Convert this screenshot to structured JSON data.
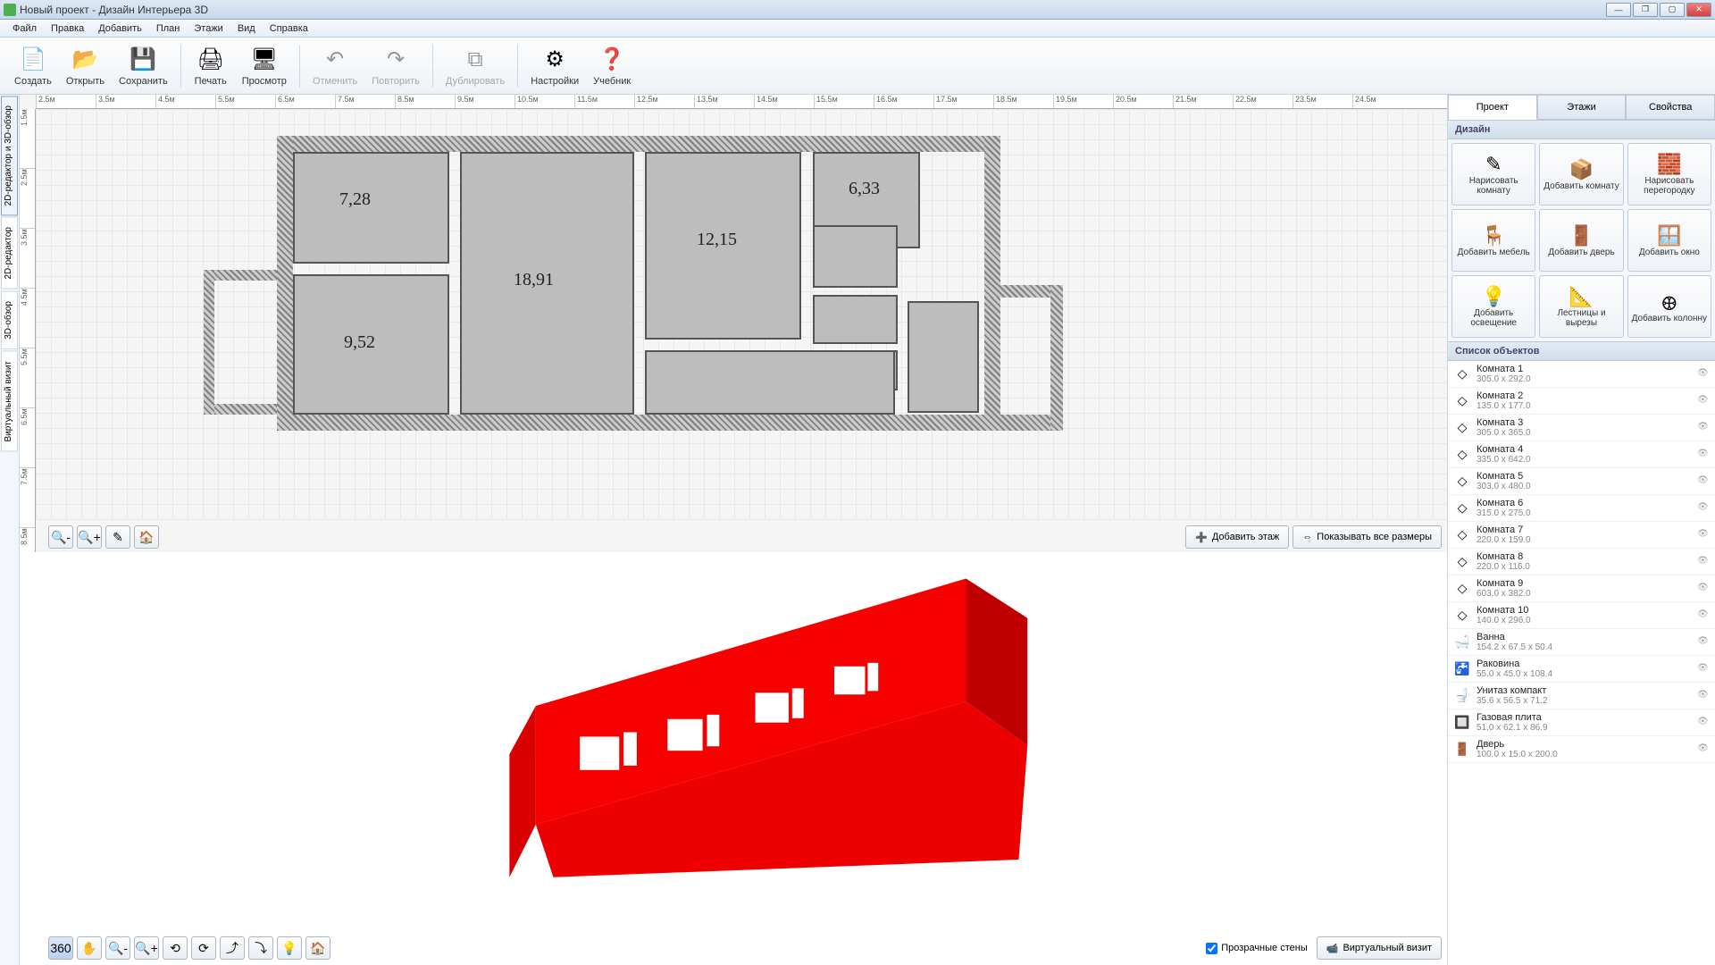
{
  "window": {
    "title": "Новый проект - Дизайн Интерьера 3D"
  },
  "menu": [
    "Файл",
    "Правка",
    "Добавить",
    "План",
    "Этажи",
    "Вид",
    "Справка"
  ],
  "toolbar": [
    {
      "id": "create",
      "label": "Создать",
      "glyph": "📄"
    },
    {
      "id": "open",
      "label": "Открыть",
      "glyph": "📂"
    },
    {
      "id": "save",
      "label": "Сохранить",
      "glyph": "💾"
    },
    {
      "sep": true
    },
    {
      "id": "print",
      "label": "Печать",
      "glyph": "🖨"
    },
    {
      "id": "preview",
      "label": "Просмотр",
      "glyph": "🖥"
    },
    {
      "sep": true
    },
    {
      "id": "undo",
      "label": "Отменить",
      "glyph": "↶",
      "dis": true
    },
    {
      "id": "redo",
      "label": "Повторить",
      "glyph": "↷",
      "dis": true
    },
    {
      "sep": true
    },
    {
      "id": "dup",
      "label": "Дублировать",
      "glyph": "⧉",
      "dis": true
    },
    {
      "sep": true
    },
    {
      "id": "settings",
      "label": "Настройки",
      "glyph": "⚙"
    },
    {
      "id": "tutorial",
      "label": "Учебник",
      "glyph": "❓"
    }
  ],
  "sideTabs": [
    {
      "id": "both",
      "label": "2D-редактор и 3D-обзор",
      "active": true
    },
    {
      "id": "2d",
      "label": "2D-редактор"
    },
    {
      "id": "3d",
      "label": "3D-обзор"
    },
    {
      "id": "virtual",
      "label": "Виртуальный визит"
    }
  ],
  "ruler": {
    "h": [
      "2.5м",
      "3.5м",
      "4.5м",
      "5.5м",
      "6.5м",
      "7.5м",
      "8.5м",
      "9.5м",
      "10.5м",
      "11.5м",
      "12.5м",
      "13.5м",
      "14.5м",
      "15.5м",
      "16.5м",
      "17.5м",
      "18.5м",
      "19.5м",
      "20.5м",
      "21.5м",
      "22.5м",
      "23.5м",
      "24.5м"
    ],
    "v": [
      "1.5м",
      "2.5м",
      "3.5м",
      "4.5м",
      "5.5м",
      "6.5м",
      "7.5м",
      "8.5м"
    ]
  },
  "rooms": {
    "r1": "7,28",
    "r2": "18,91",
    "r3": "12,15",
    "r4": "6,33",
    "r5": "9,52"
  },
  "planButtons": {
    "addFloor": "Добавить этаж",
    "showDims": "Показывать все размеры"
  },
  "view3d": {
    "transparent": "Прозрачные стены",
    "virtual": "Виртуальный визит"
  },
  "rtabs": {
    "project": "Проект",
    "floors": "Этажи",
    "props": "Свойства"
  },
  "sections": {
    "design": "Дизайн",
    "objects": "Список объектов"
  },
  "design": [
    {
      "id": "draw-room",
      "label": "Нарисовать комнату",
      "glyph": "✎"
    },
    {
      "id": "add-room",
      "label": "Добавить комнату",
      "glyph": "📦"
    },
    {
      "id": "draw-partition",
      "label": "Нарисовать перегородку",
      "glyph": "🧱"
    },
    {
      "id": "add-furniture",
      "label": "Добавить мебель",
      "glyph": "🪑"
    },
    {
      "id": "add-door",
      "label": "Добавить дверь",
      "glyph": "🚪"
    },
    {
      "id": "add-window",
      "label": "Добавить окно",
      "glyph": "🪟"
    },
    {
      "id": "add-light",
      "label": "Добавить освещение",
      "glyph": "💡"
    },
    {
      "id": "stairs",
      "label": "Лестницы и вырезы",
      "glyph": "📐"
    },
    {
      "id": "add-column",
      "label": "Добавить колонну",
      "glyph": "𐃏"
    }
  ],
  "objects": [
    {
      "name": "Комната 1",
      "dim": "305.0 x 292.0",
      "icon": "◇"
    },
    {
      "name": "Комната 2",
      "dim": "135.0 x 177.0",
      "icon": "◇"
    },
    {
      "name": "Комната 3",
      "dim": "305.0 x 365.0",
      "icon": "◇"
    },
    {
      "name": "Комната 4",
      "dim": "335.0 x 642.0",
      "icon": "◇"
    },
    {
      "name": "Комната 5",
      "dim": "303.0 x 480.0",
      "icon": "◇"
    },
    {
      "name": "Комната 6",
      "dim": "315.0 x 275.0",
      "icon": "◇"
    },
    {
      "name": "Комната 7",
      "dim": "220.0 x 159.0",
      "icon": "◇"
    },
    {
      "name": "Комната 8",
      "dim": "220.0 x 116.0",
      "icon": "◇"
    },
    {
      "name": "Комната 9",
      "dim": "603.0 x 382.0",
      "icon": "◇"
    },
    {
      "name": "Комната 10",
      "dim": "140.0 x 296.0",
      "icon": "◇"
    },
    {
      "name": "Ванна",
      "dim": "154.2 x 67.5 x 50.4",
      "icon": "🛁"
    },
    {
      "name": "Раковина",
      "dim": "55.0 x 45.0 x 108.4",
      "icon": "🚰"
    },
    {
      "name": "Унитаз компакт",
      "dim": "35.6 x 56.5 x 71.2",
      "icon": "🚽"
    },
    {
      "name": "Газовая плита",
      "dim": "51.0 x 62.1 x 86.9",
      "icon": "🔲"
    },
    {
      "name": "Дверь",
      "dim": "100.0 x 15.0 x 200.0",
      "icon": "🚪"
    }
  ]
}
